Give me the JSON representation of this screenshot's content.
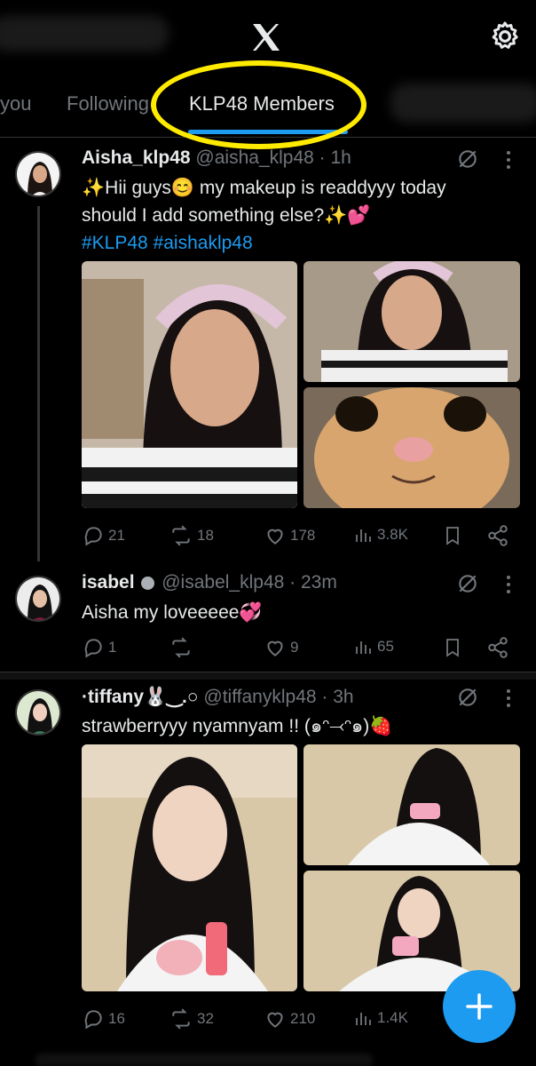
{
  "tabs": {
    "items": [
      {
        "label": "you"
      },
      {
        "label": "Following"
      },
      {
        "label": "KLP48 Members"
      }
    ]
  },
  "posts": [
    {
      "name": "Aisha_klp48",
      "handle": "@aisha_klp48",
      "time": "· 1h",
      "line1": "✨Hii guys😊 my makeup is readdyyy today",
      "line2": "should I add something else?✨💕",
      "hashtags": "#KLP48 #aishaklp48",
      "replies": "21",
      "reposts": "18",
      "likes": "178",
      "views": "3.8K"
    },
    {
      "name": "isabel",
      "handle": "@isabel_klp48",
      "time": "· 23m",
      "line1": "Aisha my loveeeee💞",
      "replies": "1",
      "reposts": "",
      "likes": "9",
      "views": "65"
    },
    {
      "name": "·tiffany🐰‿.○",
      "handle": "@tiffanyklp48",
      "time": "· 3h",
      "line1": "strawberryyy nyamnyam !! (๑ᵔ⤙ᵔ๑)🍓",
      "replies": "16",
      "reposts": "32",
      "likes": "210",
      "views": "1.4K"
    }
  ],
  "colors": {
    "accent": "#1d9bf0",
    "highlight": "#ffeb00",
    "muted": "#71767b",
    "text": "#e7e9ea"
  },
  "icons": {
    "logo": "x-logo-icon",
    "settings": "gear-icon",
    "fab": "plus-icon"
  }
}
